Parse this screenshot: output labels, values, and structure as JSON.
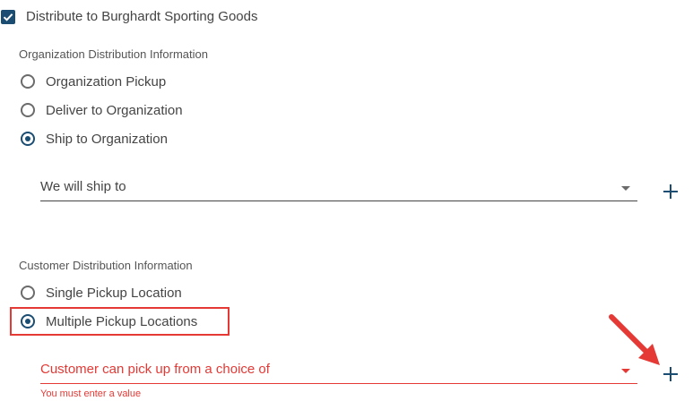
{
  "distribute": {
    "label": "Distribute to Burghardt Sporting Goods",
    "checked": true
  },
  "org_section": {
    "title": "Organization Distribution Information",
    "options": [
      {
        "label": "Organization Pickup",
        "checked": false
      },
      {
        "label": "Deliver to Organization",
        "checked": false
      },
      {
        "label": "Ship to Organization",
        "checked": true
      }
    ],
    "select_placeholder": "We will ship to"
  },
  "customer_section": {
    "title": "Customer Distribution Information",
    "options": [
      {
        "label": "Single Pickup Location",
        "checked": false
      },
      {
        "label": "Multiple Pickup Locations",
        "checked": true
      }
    ],
    "select_placeholder": "Customer can pick up from a choice of",
    "error": "You must enter a value"
  },
  "colors": {
    "primary": "#1b4d72",
    "error": "#e53935",
    "annotation": "#e53935"
  },
  "icons": {
    "checkbox": "check-icon",
    "add": "plus-icon",
    "dropdown": "caret-down-icon",
    "callout": "arrow-icon"
  }
}
